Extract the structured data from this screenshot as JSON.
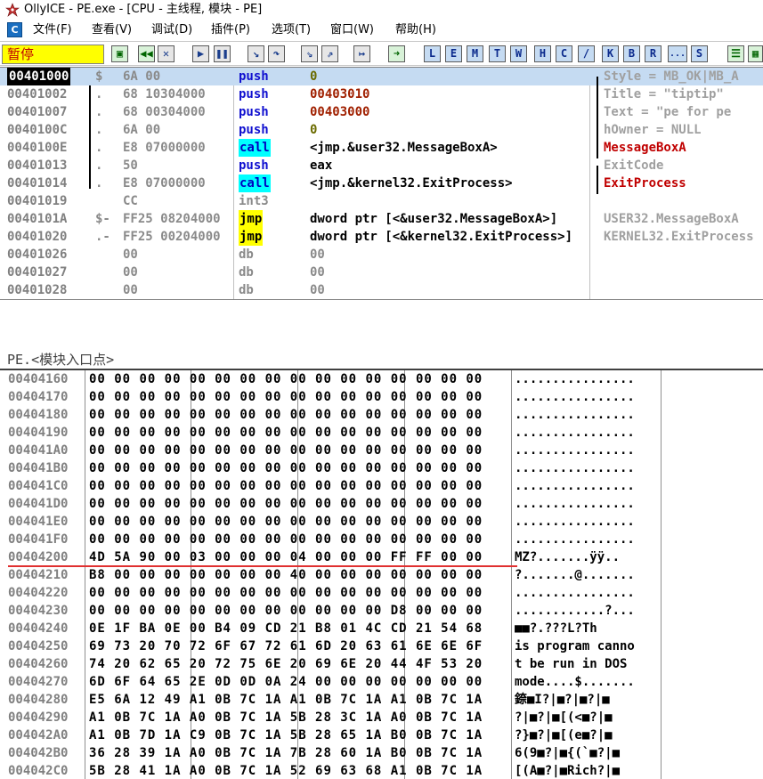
{
  "window": {
    "title": "OllyICE - PE.exe - [CPU - 主线程, 模块 - PE]"
  },
  "menu": {
    "items": [
      {
        "label": "文件(F)"
      },
      {
        "label": "查看(V)"
      },
      {
        "label": "调试(D)"
      },
      {
        "label": "插件(P)"
      },
      {
        "label": "选项(T)"
      },
      {
        "label": "窗口(W)"
      },
      {
        "label": "帮助(H)"
      }
    ],
    "icon_label": "C"
  },
  "toolbar": {
    "status": "暂停",
    "letters": [
      "L",
      "E",
      "M",
      "T",
      "W",
      "H",
      "C",
      "/",
      "K",
      "B",
      "R",
      "...",
      "S"
    ]
  },
  "cpu": {
    "rows": [
      {
        "addr": "00401000",
        "mk": "$",
        "hex": "6A 00",
        "mn": "push",
        "op": "0",
        "cm": "Style = MB_OK|MB_A"
      },
      {
        "addr": "00401002",
        "mk": ".",
        "hex": "68 10304000",
        "mn": "push",
        "op": "00403010",
        "cm": "Title = \"tiptip\""
      },
      {
        "addr": "00401007",
        "mk": ".",
        "hex": "68 00304000",
        "mn": "push",
        "op": "00403000",
        "cm": "Text = \"pe for pe"
      },
      {
        "addr": "0040100C",
        "mk": ".",
        "hex": "6A 00",
        "mn": "push",
        "op": "0",
        "cm": "hOwner = NULL"
      },
      {
        "addr": "0040100E",
        "mk": ".",
        "hex": "E8 07000000",
        "mn": "call",
        "op": "<jmp.&user32.MessageBoxA>",
        "cm": "MessageBoxA"
      },
      {
        "addr": "00401013",
        "mk": ".",
        "hex": "50",
        "mn": "push",
        "op": "eax",
        "cm": "ExitCode"
      },
      {
        "addr": "00401014",
        "mk": ".",
        "hex": "E8 07000000",
        "mn": "call",
        "op": "<jmp.&kernel32.ExitProcess>",
        "cm": "ExitProcess"
      },
      {
        "addr": "00401019",
        "mk": "",
        "hex": "CC",
        "mn": "int3",
        "op": "",
        "cm": ""
      },
      {
        "addr": "0040101A",
        "mk": "$-",
        "hex": "FF25 08204000",
        "mn": "jmp",
        "op": "dword ptr [<&user32.MessageBoxA>]",
        "cm": "USER32.MessageBoxA"
      },
      {
        "addr": "00401020",
        "mk": ".-",
        "hex": "FF25 00204000",
        "mn": "jmp",
        "op": "dword ptr [<&kernel32.ExitProcess>]",
        "cm": "KERNEL32.ExitProcess"
      },
      {
        "addr": "00401026",
        "mk": "",
        "hex": "00",
        "mn": "db",
        "op": "00",
        "cm": ""
      },
      {
        "addr": "00401027",
        "mk": "",
        "hex": "00",
        "mn": "db",
        "op": "00",
        "cm": ""
      },
      {
        "addr": "00401028",
        "mk": "",
        "hex": "00",
        "mn": "db",
        "op": "00",
        "cm": ""
      }
    ]
  },
  "info": {
    "text": "PE.<模块入口点>"
  },
  "dump": {
    "rows": [
      {
        "addr": "00404160",
        "hex": "00 00 00 00 00 00 00 00 00 00 00 00 00 00 00 00",
        "asc": "................"
      },
      {
        "addr": "00404170",
        "hex": "00 00 00 00 00 00 00 00 00 00 00 00 00 00 00 00",
        "asc": "................"
      },
      {
        "addr": "00404180",
        "hex": "00 00 00 00 00 00 00 00 00 00 00 00 00 00 00 00",
        "asc": "................"
      },
      {
        "addr": "00404190",
        "hex": "00 00 00 00 00 00 00 00 00 00 00 00 00 00 00 00",
        "asc": "................"
      },
      {
        "addr": "004041A0",
        "hex": "00 00 00 00 00 00 00 00 00 00 00 00 00 00 00 00",
        "asc": "................"
      },
      {
        "addr": "004041B0",
        "hex": "00 00 00 00 00 00 00 00 00 00 00 00 00 00 00 00",
        "asc": "................"
      },
      {
        "addr": "004041C0",
        "hex": "00 00 00 00 00 00 00 00 00 00 00 00 00 00 00 00",
        "asc": "................"
      },
      {
        "addr": "004041D0",
        "hex": "00 00 00 00 00 00 00 00 00 00 00 00 00 00 00 00",
        "asc": "................"
      },
      {
        "addr": "004041E0",
        "hex": "00 00 00 00 00 00 00 00 00 00 00 00 00 00 00 00",
        "asc": "................"
      },
      {
        "addr": "004041F0",
        "hex": "00 00 00 00 00 00 00 00 00 00 00 00 00 00 00 00",
        "asc": "................"
      },
      {
        "addr": "00404200",
        "hex": "4D 5A 90 00 03 00 00 00 04 00 00 00 FF FF 00 00",
        "asc": "MZ?.......ÿÿ.."
      },
      {
        "addr": "00404210",
        "hex": "B8 00 00 00 00 00 00 00 40 00 00 00 00 00 00 00",
        "asc": "?.......@......."
      },
      {
        "addr": "00404220",
        "hex": "00 00 00 00 00 00 00 00 00 00 00 00 00 00 00 00",
        "asc": "................"
      },
      {
        "addr": "00404230",
        "hex": "00 00 00 00 00 00 00 00 00 00 00 00 D8 00 00 00",
        "asc": "............?..."
      },
      {
        "addr": "00404240",
        "hex": "0E 1F BA 0E 00 B4 09 CD 21 B8 01 4C CD 21 54 68",
        "asc": "■■?.???L?Th"
      },
      {
        "addr": "00404250",
        "hex": "69 73 20 70 72 6F 67 72 61 6D 20 63 61 6E 6E 6F",
        "asc": "is program canno"
      },
      {
        "addr": "00404260",
        "hex": "74 20 62 65 20 72 75 6E 20 69 6E 20 44 4F 53 20",
        "asc": "t be run in DOS "
      },
      {
        "addr": "00404270",
        "hex": "6D 6F 64 65 2E 0D 0D 0A 24 00 00 00 00 00 00 00",
        "asc": "mode....$......."
      },
      {
        "addr": "00404280",
        "hex": "E5 6A 12 49 A1 0B 7C 1A A1 0B 7C 1A A1 0B 7C 1A",
        "asc": "錼■I?|■?|■?|■"
      },
      {
        "addr": "00404290",
        "hex": "A1 0B 7C 1A A0 0B 7C 1A 5B 28 3C 1A A0 0B 7C 1A",
        "asc": "?|■?|■[(<■?|■"
      },
      {
        "addr": "004042A0",
        "hex": "A1 0B 7D 1A C9 0B 7C 1A 5B 28 65 1A B0 0B 7C 1A",
        "asc": "?}■?|■[(e■?|■"
      },
      {
        "addr": "004042B0",
        "hex": "36 28 39 1A A0 0B 7C 1A 7B 28 60 1A B0 0B 7C 1A",
        "asc": "6(9■?|■{(`■?|■"
      },
      {
        "addr": "004042C0",
        "hex": "5B 28 41 1A A0 0B 7C 1A 52 69 63 68 A1 0B 7C 1A",
        "asc": "[(A■?|■Rich?|■"
      }
    ]
  }
}
